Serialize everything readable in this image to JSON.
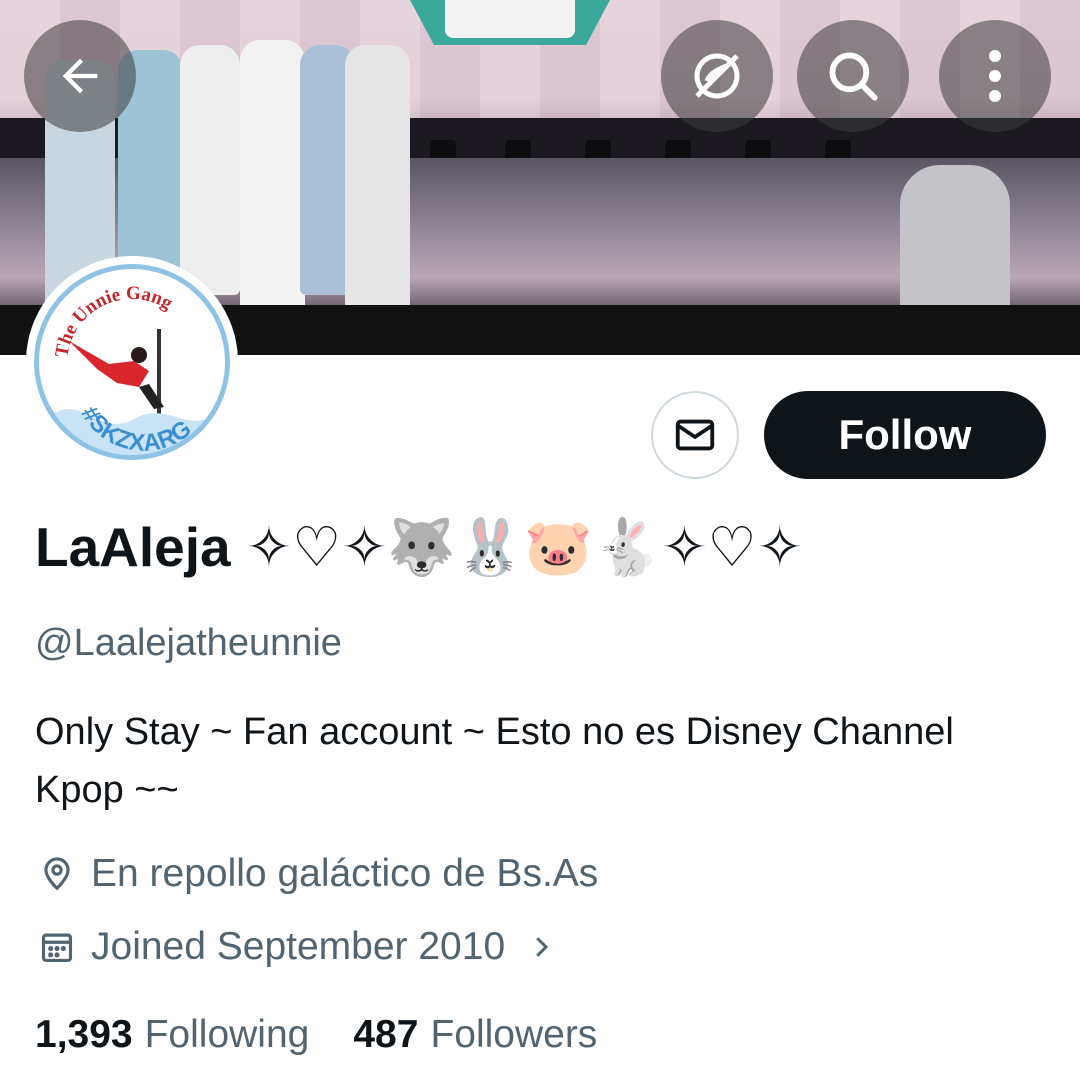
{
  "header": {
    "back_icon": "arrow-left-icon",
    "translate_icon": "globe-slash-icon",
    "search_icon": "search-icon",
    "more_icon": "more-vertical-icon"
  },
  "avatar": {
    "ring_text_top": "The Unnie Gang",
    "ring_text_bottom": "#SKZXARG"
  },
  "actions": {
    "message_icon": "envelope-icon",
    "follow_label": "Follow"
  },
  "profile": {
    "display_name": "LaAleja ✧♡✧🐺🐰🐷🐇✧♡✧",
    "handle": "@Laalejatheunnie",
    "bio": "Only Stay ~ Fan account ~ Esto no es Disney Channel Kpop ~~",
    "location": "En repollo galáctico de Bs.As",
    "joined": "Joined September 2010"
  },
  "stats": {
    "following_count": "1,393",
    "following_label": "Following",
    "followers_count": "487",
    "followers_label": "Followers"
  },
  "colors": {
    "text": "#0f1419",
    "secondary": "#536471",
    "follow_bg": "#0f1419",
    "border": "#cfd9de"
  }
}
